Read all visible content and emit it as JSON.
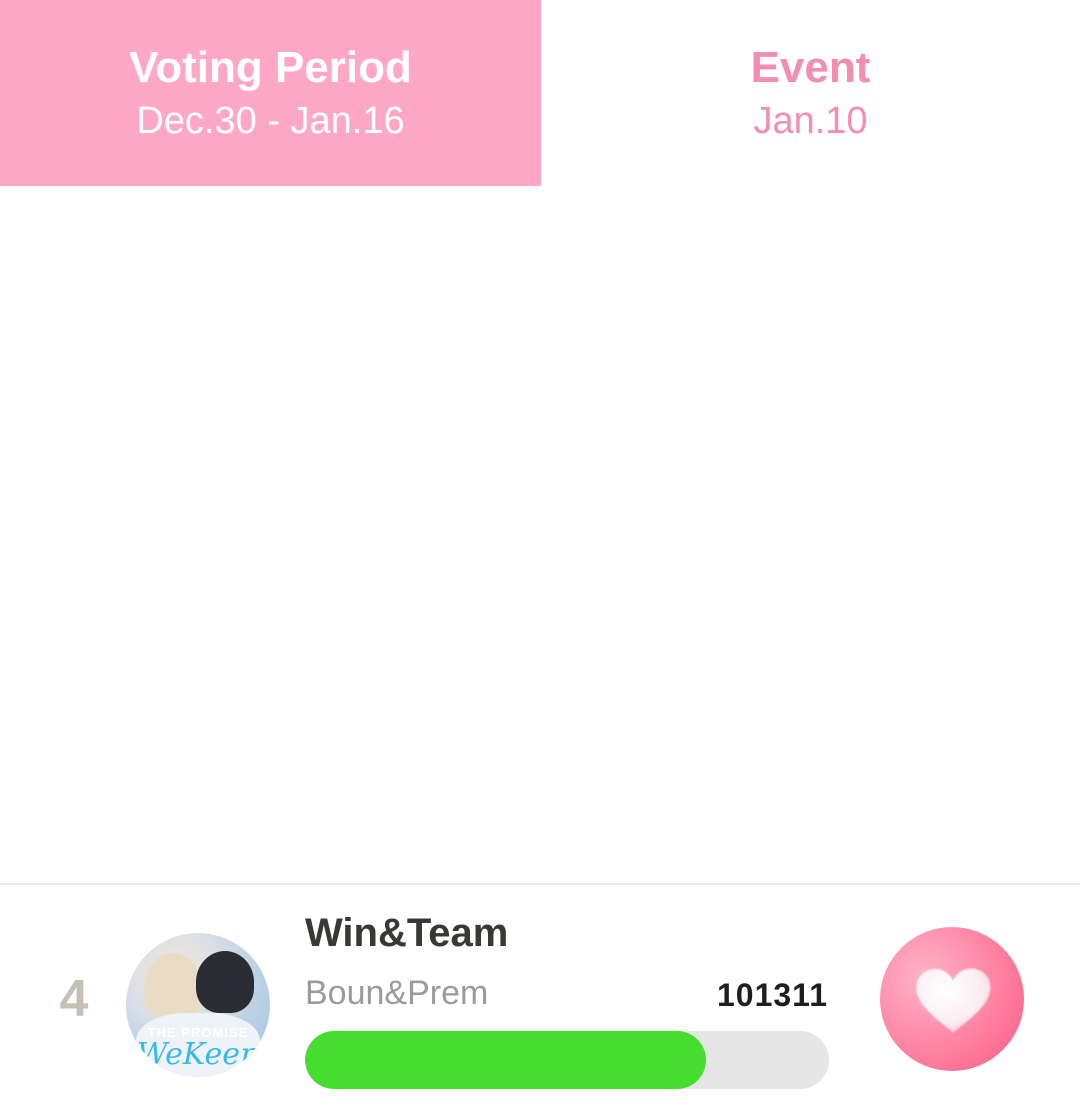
{
  "tabs": [
    {
      "title": "Voting Period",
      "subtitle": "Dec.30 - Jan.16",
      "active": true
    },
    {
      "title": "Event",
      "subtitle": "Jan.10",
      "active": false
    }
  ],
  "entry": {
    "rank": "4",
    "name": "Win&Team",
    "sub_name": "Boun&Prem",
    "votes": "101311",
    "progress_fraction": 0.765,
    "avatar": {
      "poster_text": "THE PROMISE",
      "poster_script": "WeKeep"
    }
  },
  "colors": {
    "active_tab": "#ffa8c5",
    "inactive_tab_text": "#f58db0",
    "progress_fill": "#45dd2e",
    "progress_track": "#e6e6e6",
    "vote_button": "#fb5a84"
  },
  "icons": {
    "vote": "heart-icon"
  }
}
